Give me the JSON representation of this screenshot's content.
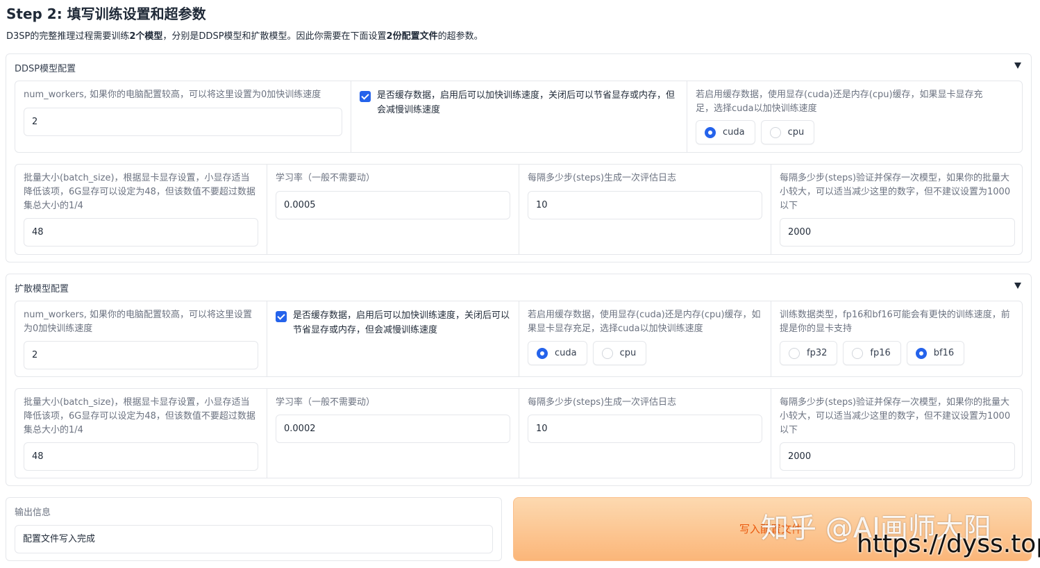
{
  "page": {
    "title": "Step 2: 填写训练设置和超参数",
    "desc_parts": [
      "D3SP的完整推理过程需要训练",
      "2个模型",
      "，分别是DDSP模型和扩散模型。因此你需要在下面设置",
      "2份配置文件",
      "的超参数。"
    ]
  },
  "ddsp": {
    "header": "DDSP模型配置",
    "num_workers": {
      "label": "num_workers, 如果你的电脑配置较高，可以将这里设置为0加快训练速度",
      "value": "2"
    },
    "cache": {
      "label": "是否缓存数据，启用后可以加快训练速度，关闭后可以节省显存或内存，但会减慢训练速度",
      "checked": true
    },
    "cache_device": {
      "label": "若启用缓存数据，使用显存(cuda)还是内存(cpu)缓存，如果显卡显存充足，选择cuda以加快训练速度",
      "options": [
        "cuda",
        "cpu"
      ],
      "selected": "cuda"
    },
    "batch_size": {
      "label": "批量大小(batch_size)，根据显卡显存设置，小显存适当降低该项，6G显存可以设定为48，但该数值不要超过数据集总大小的1/4",
      "value": "48"
    },
    "lr": {
      "label": "学习率（一般不需要动）",
      "value": "0.0005"
    },
    "log_interval": {
      "label": "每隔多少步(steps)生成一次评估日志",
      "value": "10"
    },
    "save_interval": {
      "label": "每隔多少步(steps)验证并保存一次模型，如果你的批量大小较大，可以适当减少这里的数字，但不建议设置为1000以下",
      "value": "2000"
    }
  },
  "diff": {
    "header": "扩散模型配置",
    "num_workers": {
      "label": "num_workers, 如果你的电脑配置较高，可以将这里设置为0加快训练速度",
      "value": "2"
    },
    "cache": {
      "label": "是否缓存数据，启用后可以加快训练速度，关闭后可以节省显存或内存，但会减慢训练速度",
      "checked": true
    },
    "cache_device": {
      "label": "若启用缓存数据，使用显存(cuda)还是内存(cpu)缓存，如果显卡显存充足，选择cuda以加快训练速度",
      "options": [
        "cuda",
        "cpu"
      ],
      "selected": "cuda"
    },
    "dtype": {
      "label": "训练数据类型，fp16和bf16可能会有更快的训练速度，前提是你的显卡支持",
      "options": [
        "fp32",
        "fp16",
        "bf16"
      ],
      "selected": "bf16"
    },
    "batch_size": {
      "label": "批量大小(batch_size)，根据显卡显存设置，小显存适当降低该项，6G显存可以设定为48，但该数值不要超过数据集总大小的1/4",
      "value": "48"
    },
    "lr": {
      "label": "学习率（一般不需要动）",
      "value": "0.0002"
    },
    "log_interval": {
      "label": "每隔多少步(steps)生成一次评估日志",
      "value": "10"
    },
    "save_interval": {
      "label": "每隔多少步(steps)验证并保存一次模型，如果你的批量大小较大，可以适当减少这里的数字，但不建议设置为1000以下",
      "value": "2000"
    }
  },
  "output": {
    "label": "输出信息",
    "value": "配置文件写入完成"
  },
  "write_button": {
    "label": "写入配置文件"
  },
  "watermark": {
    "line1": "知乎 @AI画师大阳",
    "line2": "https://dyss.top"
  },
  "colors": {
    "accent": "#2563eb",
    "button_gradient_top": "#fdd9b0",
    "button_gradient_bottom": "#fbb679",
    "button_text": "#ea580c"
  }
}
